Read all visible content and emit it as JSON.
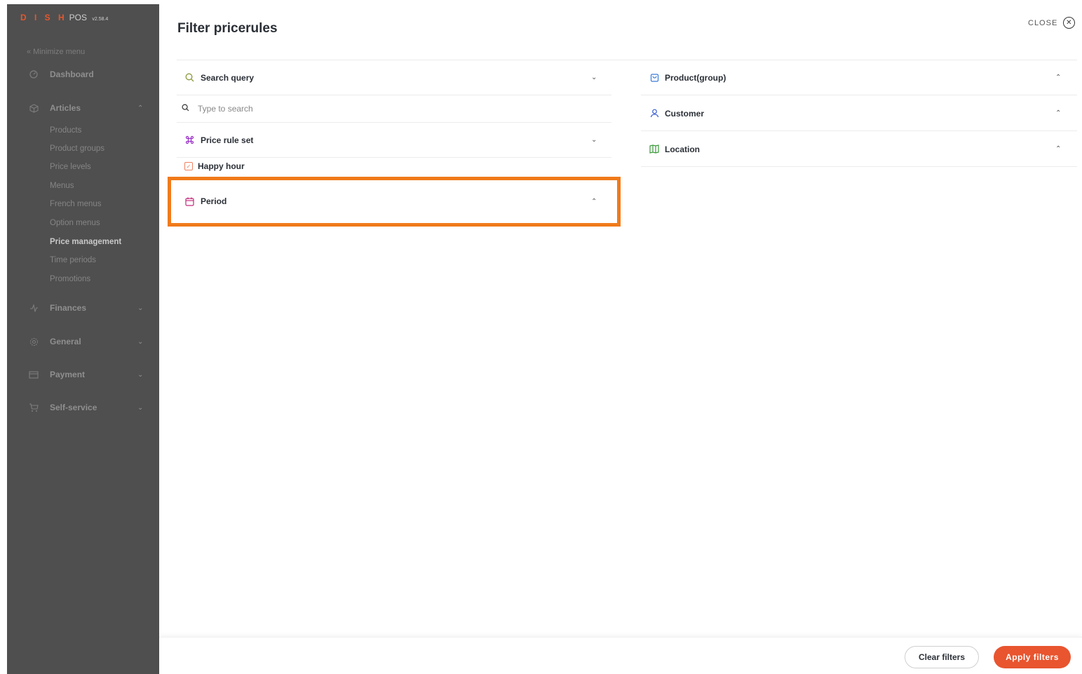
{
  "app": {
    "logo_text": "D I S H",
    "logo_pos": "POS",
    "version": "v2.58.4"
  },
  "sidebar": {
    "minimize_label": "« Minimize menu",
    "items": [
      {
        "label": "Dashboard",
        "icon": "dashboard-icon"
      },
      {
        "label": "Articles",
        "icon": "box-icon",
        "expanded": true
      },
      {
        "label": "Finances",
        "icon": "activity-icon"
      },
      {
        "label": "General",
        "icon": "gear-icon"
      },
      {
        "label": "Payment",
        "icon": "card-icon"
      },
      {
        "label": "Self-service",
        "icon": "cart-icon"
      }
    ],
    "article_subitems": [
      "Products",
      "Product groups",
      "Price levels",
      "Menus",
      "French menus",
      "Option menus",
      "Price management",
      "Time periods",
      "Promotions"
    ],
    "active_subitem": "Price management"
  },
  "panel": {
    "title": "Filter pricerules",
    "close_label": "CLOSE",
    "left_sections": {
      "search_query": "Search query",
      "search_placeholder": "Type to search",
      "price_rule_set": "Price rule set",
      "price_rule_item": "Happy hour",
      "period": "Period"
    },
    "right_sections": {
      "product_group": "Product(group)",
      "customer": "Customer",
      "location": "Location"
    },
    "clear_label": "Clear filters",
    "apply_label": "Apply filters"
  },
  "colors": {
    "accent": "#e8552f",
    "highlight": "#f07a1a",
    "sidebar_bg": "#4f4f4f"
  }
}
